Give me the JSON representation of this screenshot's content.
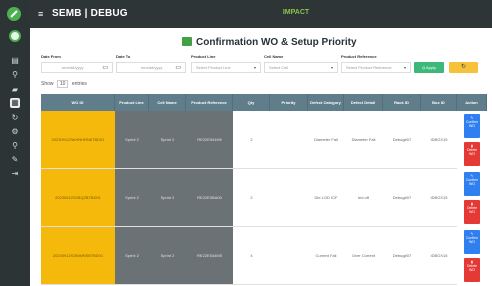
{
  "header": {
    "title": "SEMB | DEBUG",
    "brand": "IMPACT"
  },
  "page": {
    "title": "Confirmation WO & Setup Priority"
  },
  "filters": {
    "date_from_label": "Date From",
    "date_from_value": "mm/dd/yyyy",
    "date_to_label": "Date To",
    "date_to_value": "mm/dd/yyyy",
    "product_line_label": "Product Line",
    "product_line_placeholder": "Select Product Line",
    "cell_name_label": "Cell Name",
    "cell_name_placeholder": "Select Cell",
    "product_reference_label": "Product Reference",
    "product_reference_placeholder": "Select Product Reference",
    "apply_label": "Q Apply",
    "reset_label": "↻"
  },
  "table": {
    "show_prefix": "Show",
    "show_value": "10",
    "show_suffix": "entries",
    "columns": [
      "WO ID",
      "Product Line",
      "Cell Name",
      "Product Reference",
      "Qty",
      "Priority",
      "Defect Category",
      "Defect Detail",
      "Rack ID",
      "Box ID",
      "Action"
    ],
    "rows": [
      {
        "wo_id": "202309122WHNHRN8TBD01",
        "product_line": "Sprint 2",
        "cell_name": "Sprint 2",
        "product_reference": "RE22E544H5",
        "qty": "2",
        "priority": "",
        "defect_category": "Diameter Fail",
        "defect_detail": "Diameter Fail",
        "rack_id": "Debug#07",
        "box_id": "IDBOX15"
      },
      {
        "wo_id": "20230912S2BQ2BTBD01",
        "product_line": "Sprint 2",
        "cell_name": "Sprint 2",
        "product_reference": "RE22E0BA00",
        "qty": "2",
        "priority": "",
        "defect_category": "Die LOD ICF",
        "defect_detail": "led off",
        "rack_id": "Debug#07",
        "box_id": "IDBOX15"
      },
      {
        "wo_id": "20230912S2MWNSB7BD01",
        "product_line": "Sprint 2",
        "cell_name": "Sprint 2",
        "product_reference": "RE22E544M5",
        "qty": "4",
        "priority": "",
        "defect_category": "Current Fail",
        "defect_detail": "Over Current",
        "rack_id": "Debug#07",
        "box_id": "IDBOX15"
      }
    ],
    "action_confirm": "Confirm WO",
    "action_delete": "Delete WO"
  },
  "colors": {
    "sidebar": "#2d3436",
    "header": "#2e3537",
    "table_header": "#607d8b",
    "wo_cell": "#f5b90b",
    "dark_cell": "#6b7275",
    "apply": "#3cb878",
    "reset": "#f7c23b",
    "confirm": "#2f7ff0",
    "delete": "#e53935"
  },
  "icons": [
    "logo-icon",
    "avatar-icon",
    "dashboard-icon",
    "search-icon",
    "truck-icon",
    "settings-icon",
    "refresh-icon",
    "pin-icon",
    "logout-icon",
    "table-icon",
    "calendar-icon",
    "pencil-icon",
    "trash-icon"
  ]
}
